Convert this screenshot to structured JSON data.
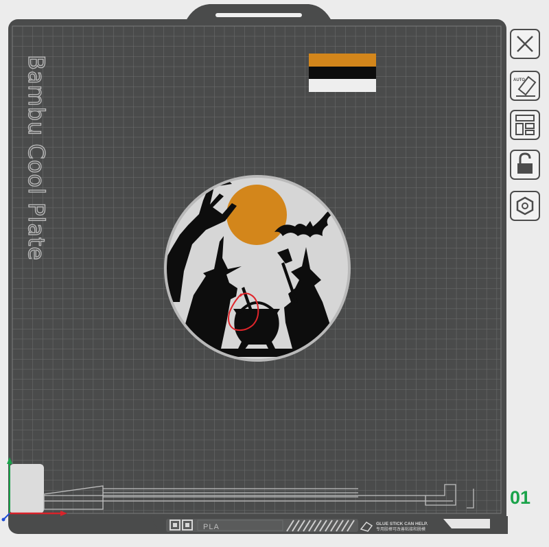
{
  "plate": {
    "brand_label": "Bambu Cool Plate",
    "material_label": "PLA",
    "glue_line1": "GLUE STICK CAN HELP.",
    "glue_line2": "专用胶棒可改善粘接和脱模"
  },
  "plate_number": "01",
  "filament_colors": [
    "#d3861b",
    "#0d0d0d",
    "#eeeeee"
  ],
  "toolbar": {
    "buttons": [
      {
        "name": "close-button",
        "icon": "close-icon"
      },
      {
        "name": "auto-orient-button",
        "icon": "auto-orient-icon",
        "icon_text": "AUTO"
      },
      {
        "name": "arrange-button",
        "icon": "arrange-icon"
      },
      {
        "name": "lock-button",
        "icon": "lock-icon"
      },
      {
        "name": "settings-button",
        "icon": "gear-icon"
      }
    ]
  },
  "colors": {
    "plate_bg": "#4a4b4b",
    "grid_line": "#6e6f6f",
    "model_disc": "#d6d6d6",
    "moon": "#d3861b",
    "silhouette": "#0d0d0d",
    "selection_outline": "#e0252b",
    "axis_x": "#d8232a",
    "axis_y": "#19a24a",
    "axis_z": "#1f4fd8",
    "plate_number": "#1aa34a"
  }
}
